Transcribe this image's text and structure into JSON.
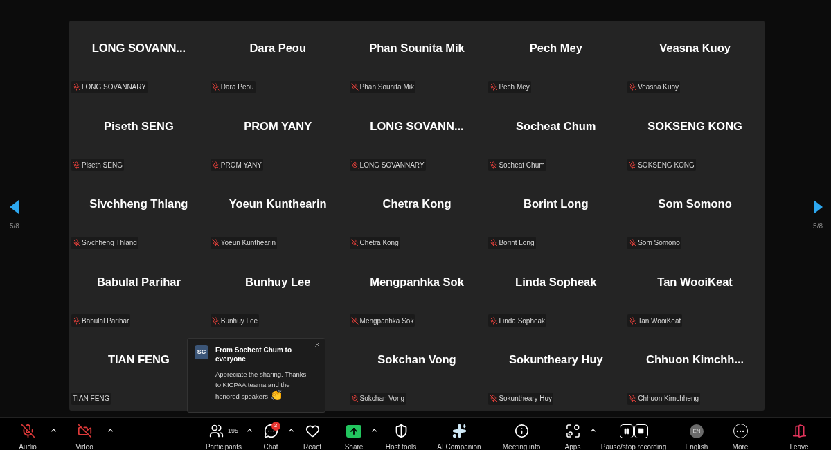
{
  "gallery": {
    "page_left": "5/8",
    "page_right": "5/8",
    "tiles": [
      {
        "name": "LONG  SOVANN...",
        "label": "LONG SOVANNARY",
        "muted": true
      },
      {
        "name": "Dara Peou",
        "label": "Dara Peou",
        "muted": true
      },
      {
        "name": "Phan Sounita Mik",
        "label": "Phan Sounita Mik",
        "muted": true
      },
      {
        "name": "Pech Mey",
        "label": "Pech Mey",
        "muted": true
      },
      {
        "name": "Veasna Kuoy",
        "label": "Veasna Kuoy",
        "muted": true
      },
      {
        "name": "Piseth SENG",
        "label": "Piseth SENG",
        "muted": true
      },
      {
        "name": "PROM YANY",
        "label": "PROM YANY",
        "muted": true
      },
      {
        "name": "LONG  SOVANN...",
        "label": "LONG SOVANNARY",
        "muted": true
      },
      {
        "name": "Socheat Chum",
        "label": "Socheat Chum",
        "muted": true
      },
      {
        "name": "SOKSENG KONG",
        "label": "SOKSENG KONG",
        "muted": true
      },
      {
        "name": "Sivchheng Thlang",
        "label": "Sivchheng Thlang",
        "muted": true
      },
      {
        "name": "Yoeun Kunthearin",
        "label": "Yoeun Kunthearin",
        "muted": true
      },
      {
        "name": "Chetra Kong",
        "label": "Chetra Kong",
        "muted": true
      },
      {
        "name": "Borint Long",
        "label": "Borint Long",
        "muted": true
      },
      {
        "name": "Som Somono",
        "label": "Som Somono",
        "muted": true
      },
      {
        "name": "Babulal Parihar",
        "label": "Babulal Parihar",
        "muted": true
      },
      {
        "name": "Bunhuy Lee",
        "label": "Bunhuy Lee",
        "muted": true
      },
      {
        "name": "Mengpanhka Sok",
        "label": "Mengpanhka Sok",
        "muted": true
      },
      {
        "name": "Linda Sopheak",
        "label": "Linda Sopheak",
        "muted": true
      },
      {
        "name": "Tan WooiKeat",
        "label": "Tan WooiKeat",
        "muted": true
      },
      {
        "name": "TIAN FENG",
        "label": "TIAN FENG",
        "muted": false
      },
      {
        "muted": false
      },
      {
        "name": "Sokchan Vong",
        "label": "Sokchan Vong",
        "muted": true
      },
      {
        "name": "Sokuntheary Huy",
        "label": "Sokuntheary Huy",
        "muted": true
      },
      {
        "name": "Chhuon  Kimchh...",
        "label": "Chhuon Kimchheng",
        "muted": true
      }
    ]
  },
  "chat_popup": {
    "initials": "SC",
    "title": "From Socheat Chum to everyone",
    "message": "Appreciate the sharing. Thanks to KICPAA teama and the honored speakers",
    "emoji": "👏"
  },
  "toolbar": [
    {
      "kind": "audio",
      "label": "Audio",
      "caret": true
    },
    {
      "kind": "video",
      "label": "Video",
      "caret": true
    },
    {
      "kind": "participants",
      "label": "Participants",
      "count": "195",
      "caret": true
    },
    {
      "kind": "chat",
      "label": "Chat",
      "badge": "3",
      "caret": true
    },
    {
      "kind": "react",
      "label": "React",
      "caret": false
    },
    {
      "kind": "share",
      "label": "Share",
      "caret": true
    },
    {
      "kind": "host",
      "label": "Host tools",
      "caret": false
    },
    {
      "kind": "ai",
      "label": "AI Companion",
      "caret": false
    },
    {
      "kind": "info",
      "label": "Meeting info",
      "caret": false
    },
    {
      "kind": "apps",
      "label": "Apps",
      "caret": true
    },
    {
      "kind": "record",
      "label": "Pause/stop recording",
      "caret": false
    },
    {
      "kind": "language",
      "label": "English",
      "code": "EN",
      "caret": false
    },
    {
      "kind": "more",
      "label": "More",
      "caret": false
    },
    {
      "kind": "leave",
      "label": "Leave",
      "caret": false
    }
  ]
}
